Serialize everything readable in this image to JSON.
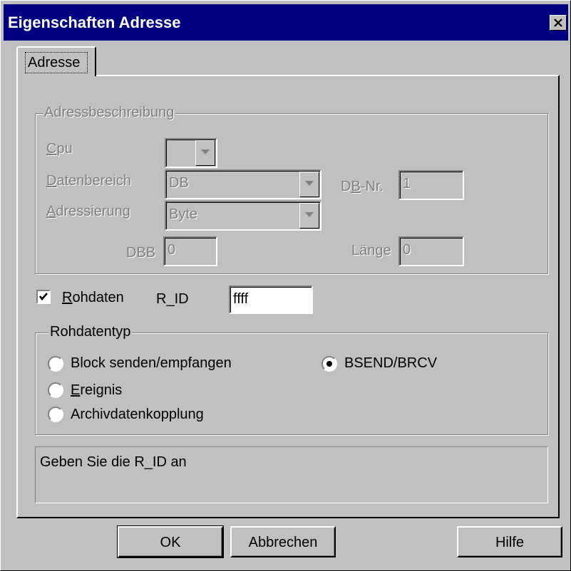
{
  "window": {
    "title": "Eigenschaften Adresse"
  },
  "tabs": [
    {
      "label": "Adresse",
      "active": true
    }
  ],
  "adressbeschreibung": {
    "legend": "Adressbeschreibung",
    "cpu": {
      "label": "Cpu",
      "value": ""
    },
    "datenbereich": {
      "label": "Datenbereich",
      "value": "DB"
    },
    "db_nr": {
      "label": "DB-Nr.",
      "value": "1"
    },
    "adressierung": {
      "label": "Adressierung",
      "value": "Byte"
    },
    "dbb": {
      "label": "DBB",
      "value": "0"
    },
    "laenge": {
      "label": "Länge",
      "value": "0"
    }
  },
  "rohdaten": {
    "label": "Rohdaten",
    "checked": true
  },
  "r_id": {
    "label": "R_ID",
    "value": "ffff"
  },
  "rohdatentyp": {
    "legend": "Rohdatentyp",
    "options": [
      {
        "label": "Block senden/empfangen",
        "selected": false
      },
      {
        "label": "BSEND/BRCV",
        "selected": true
      },
      {
        "label": "Ereignis",
        "selected": false
      },
      {
        "label": "Archivdatenkopplung",
        "selected": false
      }
    ]
  },
  "status": {
    "text": "Geben Sie die R_ID an"
  },
  "buttons": {
    "ok": "OK",
    "cancel": "Abbrechen",
    "help": "Hilfe"
  },
  "colors": {
    "titlebar": "#000080",
    "face": "#c0c0c0"
  },
  "icons": {
    "close": "close-icon",
    "dropdown": "chevron-down-icon"
  }
}
